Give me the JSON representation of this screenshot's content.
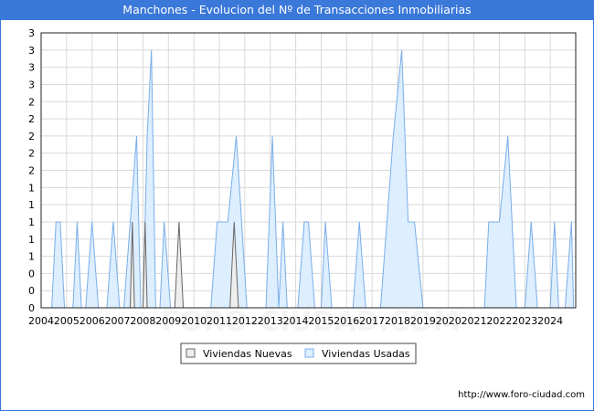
{
  "header": {
    "title": "Manchones - Evolucion del Nº de Transacciones Inmobiliarias"
  },
  "footer": {
    "url": "http://www.foro-ciudad.com"
  },
  "watermark": "FORO-CIUDAD.COM",
  "colors": {
    "title_bg": "#3a78d9",
    "nuevas_fill": "#eeeeee",
    "nuevas_line": "#666666",
    "usadas_fill": "#ddeeff",
    "usadas_line": "#7aaee8",
    "grid": "#d9d9d9",
    "watermark": "#f4f4f4"
  },
  "chart_data": {
    "type": "area",
    "title": "Manchones - Evolucion del Nº de Transacciones Inmobiliarias",
    "xlabel": "",
    "ylabel": "",
    "x_range": [
      "2004-01",
      "2024-12"
    ],
    "ylim": [
      0,
      3.2
    ],
    "y_tick_values": [
      0,
      0.2,
      0.4,
      0.6,
      0.8,
      1.0,
      1.2,
      1.4,
      1.6,
      1.8,
      2.0,
      2.2,
      2.4,
      2.6,
      2.8,
      3.0,
      3.2
    ],
    "y_tick_labels": [
      "0",
      "0",
      "0",
      "1",
      "1",
      "1",
      "1",
      "1",
      "2",
      "2",
      "2",
      "2",
      "2",
      "3",
      "3",
      "3",
      "3"
    ],
    "x_tick_labels": [
      "2004",
      "2005",
      "2006",
      "2007",
      "2008",
      "2009",
      "2010",
      "2011",
      "2012",
      "2013",
      "2014",
      "2015",
      "2016",
      "2017",
      "2018",
      "2019",
      "2020",
      "2021",
      "2022",
      "2023",
      "2024"
    ],
    "grid": true,
    "legend": {
      "placement": "bottom-center",
      "entries": [
        "Viviendas Nuevas",
        "Viviendas Usadas"
      ]
    },
    "series": [
      {
        "name": "Viviendas Nuevas",
        "points": [
          [
            "2007-07",
            0
          ],
          [
            "2007-08",
            1
          ],
          [
            "2007-09",
            0
          ],
          [
            "2008-01",
            0
          ],
          [
            "2008-02",
            1
          ],
          [
            "2008-03",
            0
          ],
          [
            "2009-04",
            0
          ],
          [
            "2009-06",
            1
          ],
          [
            "2009-08",
            0
          ],
          [
            "2011-06",
            0
          ],
          [
            "2011-08",
            1
          ],
          [
            "2011-10",
            0
          ]
        ]
      },
      {
        "name": "Viviendas Usadas",
        "points": [
          [
            "2004-06",
            0
          ],
          [
            "2004-08",
            1
          ],
          [
            "2004-10",
            1
          ],
          [
            "2004-12",
            0
          ],
          [
            "2005-04",
            0
          ],
          [
            "2005-06",
            1
          ],
          [
            "2005-08",
            0
          ],
          [
            "2005-10",
            0
          ],
          [
            "2006-01",
            1
          ],
          [
            "2006-04",
            0
          ],
          [
            "2006-08",
            0
          ],
          [
            "2006-11",
            1
          ],
          [
            "2007-02",
            0
          ],
          [
            "2007-04",
            0
          ],
          [
            "2007-07",
            1
          ],
          [
            "2007-10",
            2
          ],
          [
            "2007-12",
            0
          ],
          [
            "2008-01",
            0
          ],
          [
            "2008-03",
            2
          ],
          [
            "2008-05",
            3
          ],
          [
            "2008-07",
            0
          ],
          [
            "2008-09",
            0
          ],
          [
            "2008-11",
            1
          ],
          [
            "2009-02",
            0
          ],
          [
            "2010-09",
            0
          ],
          [
            "2010-12",
            1
          ],
          [
            "2011-05",
            1
          ],
          [
            "2011-09",
            2
          ],
          [
            "2012-02",
            0
          ],
          [
            "2012-11",
            0
          ],
          [
            "2013-02",
            2
          ],
          [
            "2013-05",
            0
          ],
          [
            "2013-05",
            0
          ],
          [
            "2013-07",
            1
          ],
          [
            "2013-09",
            0
          ],
          [
            "2014-02",
            0
          ],
          [
            "2014-05",
            1
          ],
          [
            "2014-07",
            1
          ],
          [
            "2014-10",
            0
          ],
          [
            "2015-01",
            0
          ],
          [
            "2015-03",
            1
          ],
          [
            "2015-06",
            0
          ],
          [
            "2016-04",
            0
          ],
          [
            "2016-07",
            1
          ],
          [
            "2016-10",
            0
          ],
          [
            "2017-05",
            0
          ],
          [
            "2017-11",
            2
          ],
          [
            "2018-03",
            3
          ],
          [
            "2018-06",
            1
          ],
          [
            "2018-09",
            1
          ],
          [
            "2019-01",
            0
          ],
          [
            "2021-06",
            0
          ],
          [
            "2021-08",
            1
          ],
          [
            "2022-01",
            1
          ],
          [
            "2022-05",
            2
          ],
          [
            "2022-09",
            0
          ],
          [
            "2023-01",
            0
          ],
          [
            "2023-04",
            1
          ],
          [
            "2023-07",
            0
          ],
          [
            "2024-01",
            0
          ],
          [
            "2024-03",
            1
          ],
          [
            "2024-05",
            0
          ],
          [
            "2024-08",
            0
          ],
          [
            "2024-11",
            1
          ],
          [
            "2024-12",
            0
          ]
        ]
      }
    ]
  }
}
